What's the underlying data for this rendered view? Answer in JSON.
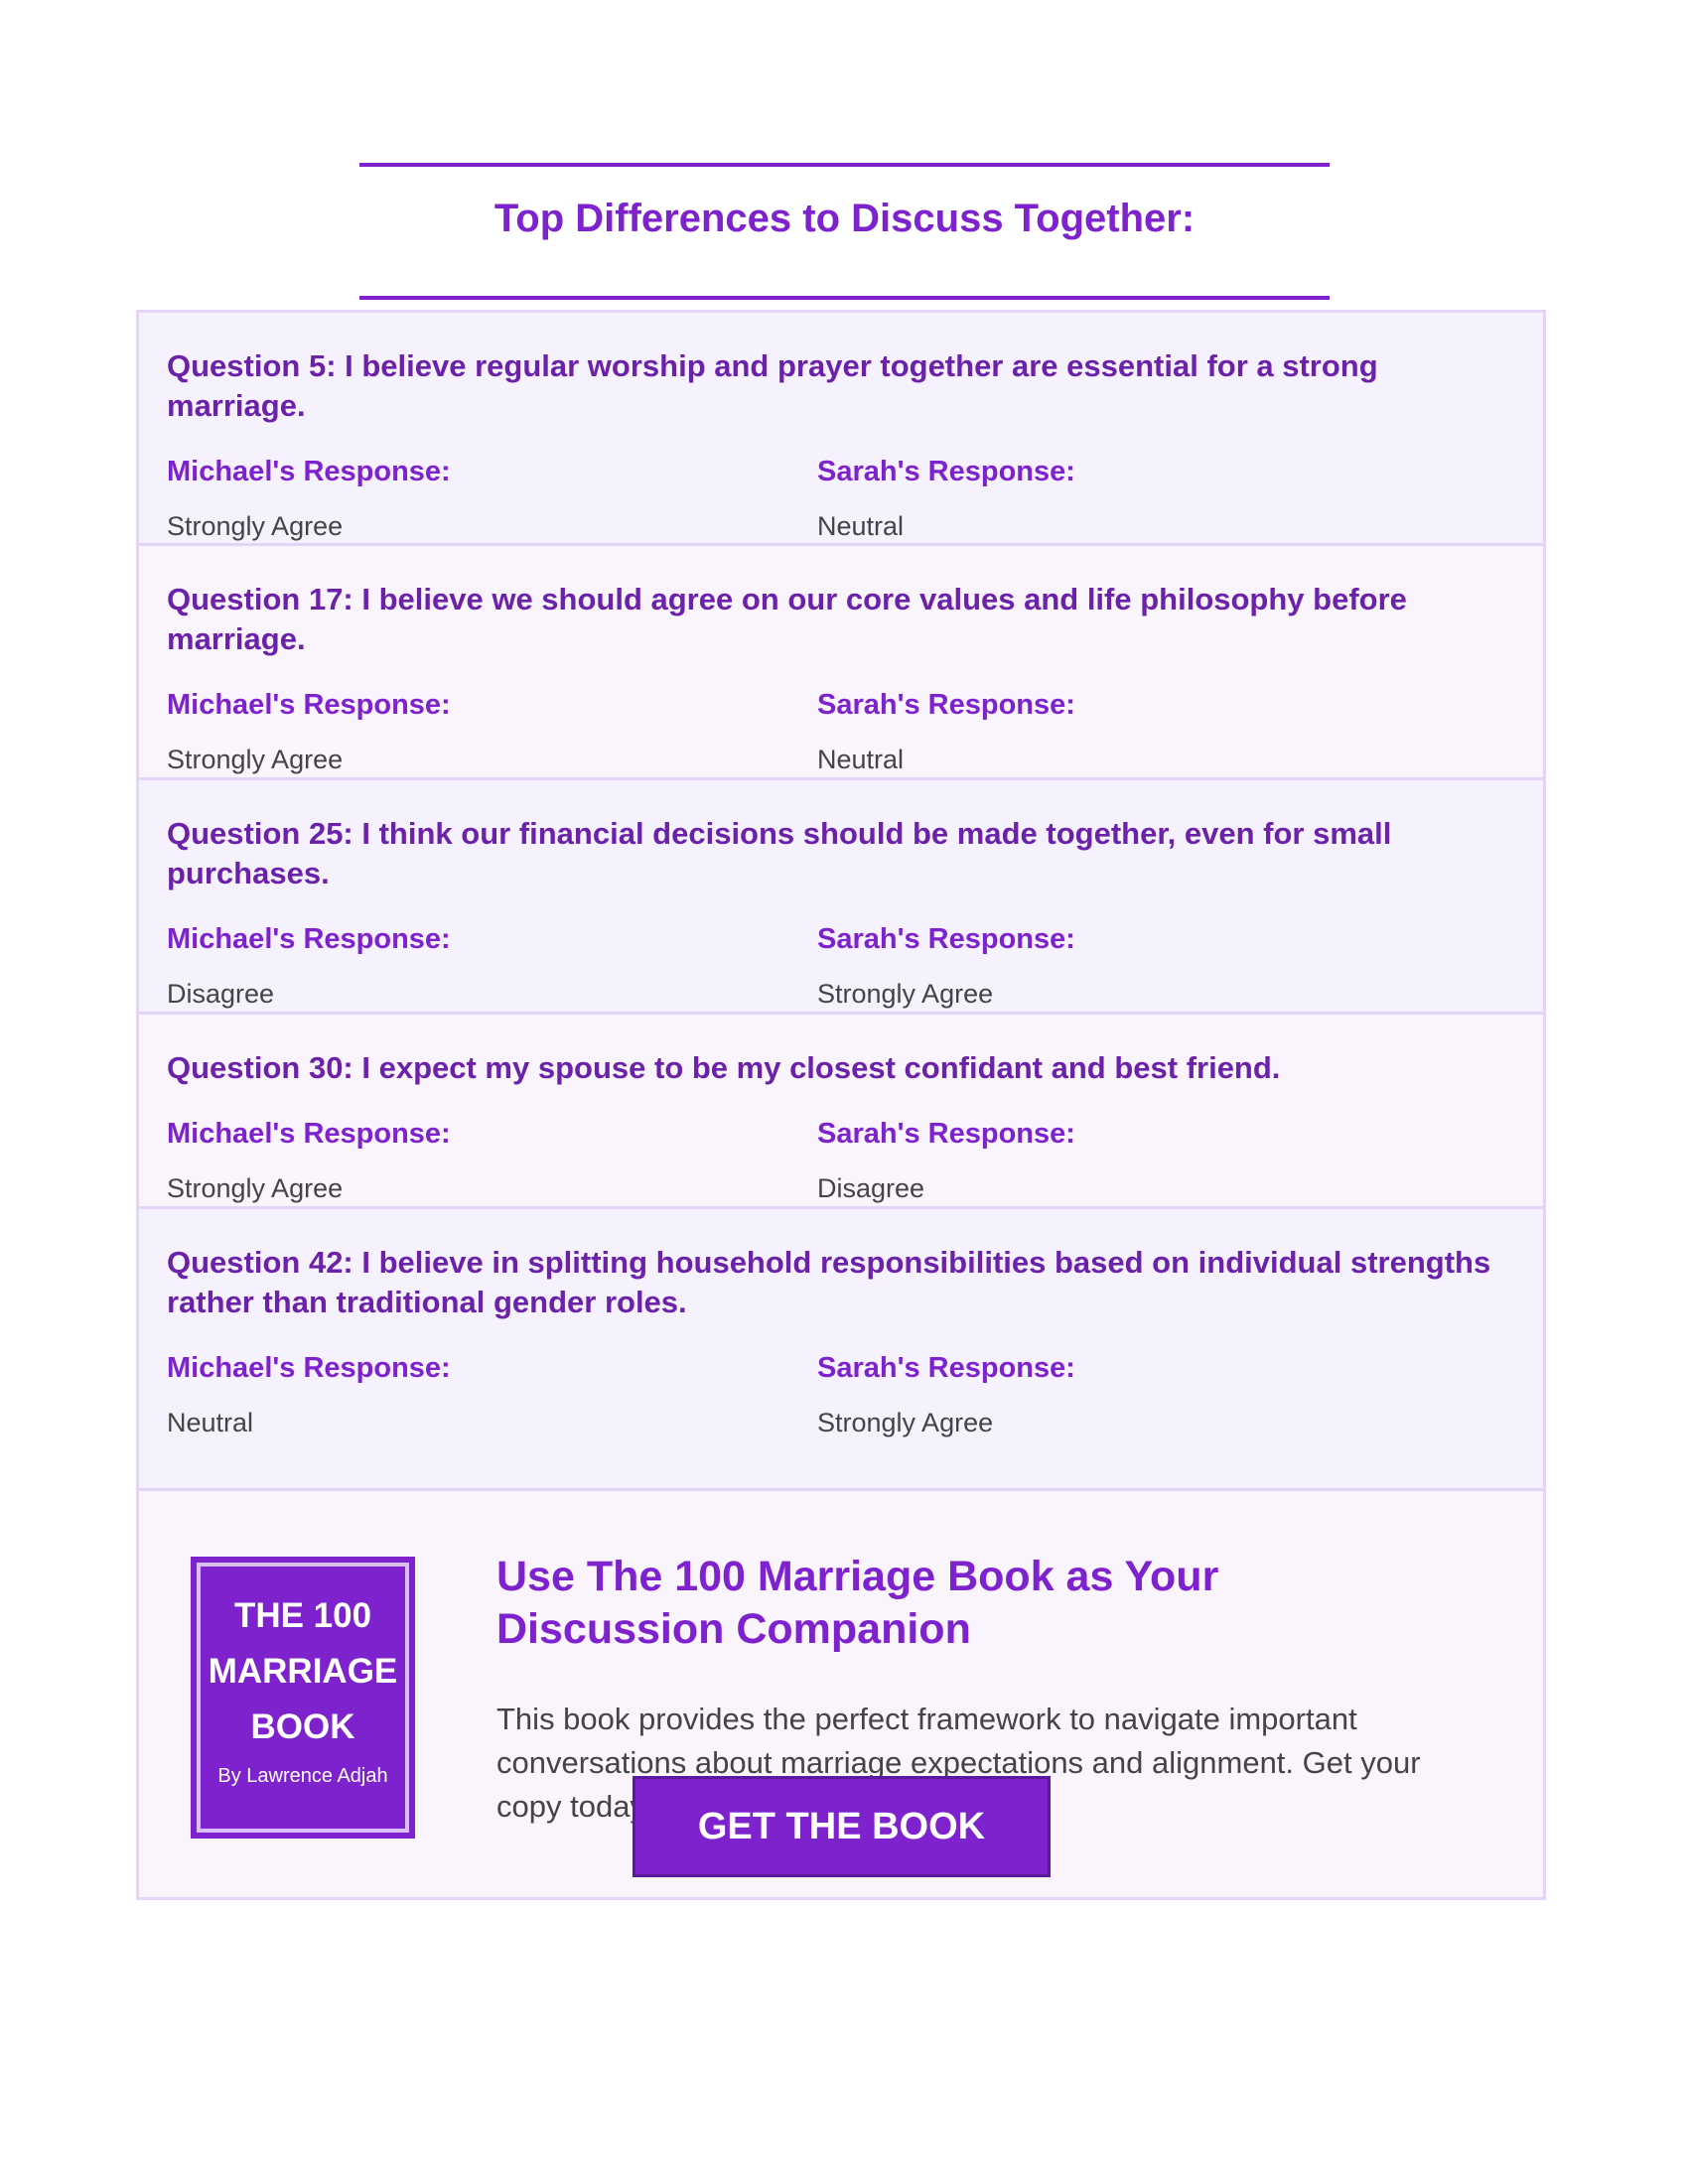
{
  "page": {
    "title": "Top Differences to Discuss Together:"
  },
  "questions": [
    {
      "title": "Question 5: I believe regular worship and prayer together are essential for a strong marriage.",
      "michael_label": "Michael's Response:",
      "michael_value": "Strongly Agree",
      "sarah_label": "Sarah's Response:",
      "sarah_value": "Neutral"
    },
    {
      "title": "Question 17: I believe we should agree on our core values and life philosophy before marriage.",
      "michael_label": "Michael's Response:",
      "michael_value": "Strongly Agree",
      "sarah_label": "Sarah's Response:",
      "sarah_value": "Neutral"
    },
    {
      "title": "Question 25: I think our financial decisions should be made together, even for small purchases.",
      "michael_label": "Michael's Response:",
      "michael_value": "Disagree",
      "sarah_label": "Sarah's Response:",
      "sarah_value": "Strongly Agree"
    },
    {
      "title": "Question 30: I expect my spouse to be my closest confidant and best friend.",
      "michael_label": "Michael's Response:",
      "michael_value": "Strongly Agree",
      "sarah_label": "Sarah's Response:",
      "sarah_value": "Disagree"
    },
    {
      "title": "Question 42: I believe in splitting household responsibilities based on individual strengths rather than traditional gender roles.",
      "michael_label": "Michael's Response:",
      "michael_value": "Neutral",
      "sarah_label": "Sarah's Response:",
      "sarah_value": "Strongly Agree"
    }
  ],
  "promo": {
    "book_cover": {
      "line1": "THE 100",
      "line2": "MARRIAGE",
      "line3": "BOOK",
      "author": "By Lawrence Adjah"
    },
    "heading": "Use The 100 Marriage Book as Your Discussion Companion",
    "text": "This book provides the perfect framework to navigate important conversations about marriage expectations and alignment. Get your copy today to deepen your relationship.",
    "cta_label": "GET THE BOOK"
  },
  "colors": {
    "accent": "#7e22ce",
    "heading_dark": "#6b21a8",
    "panel": "#f6f2fd",
    "panel_alt": "#faf4fd",
    "border": "#e4d4f7",
    "text": "#444444"
  }
}
